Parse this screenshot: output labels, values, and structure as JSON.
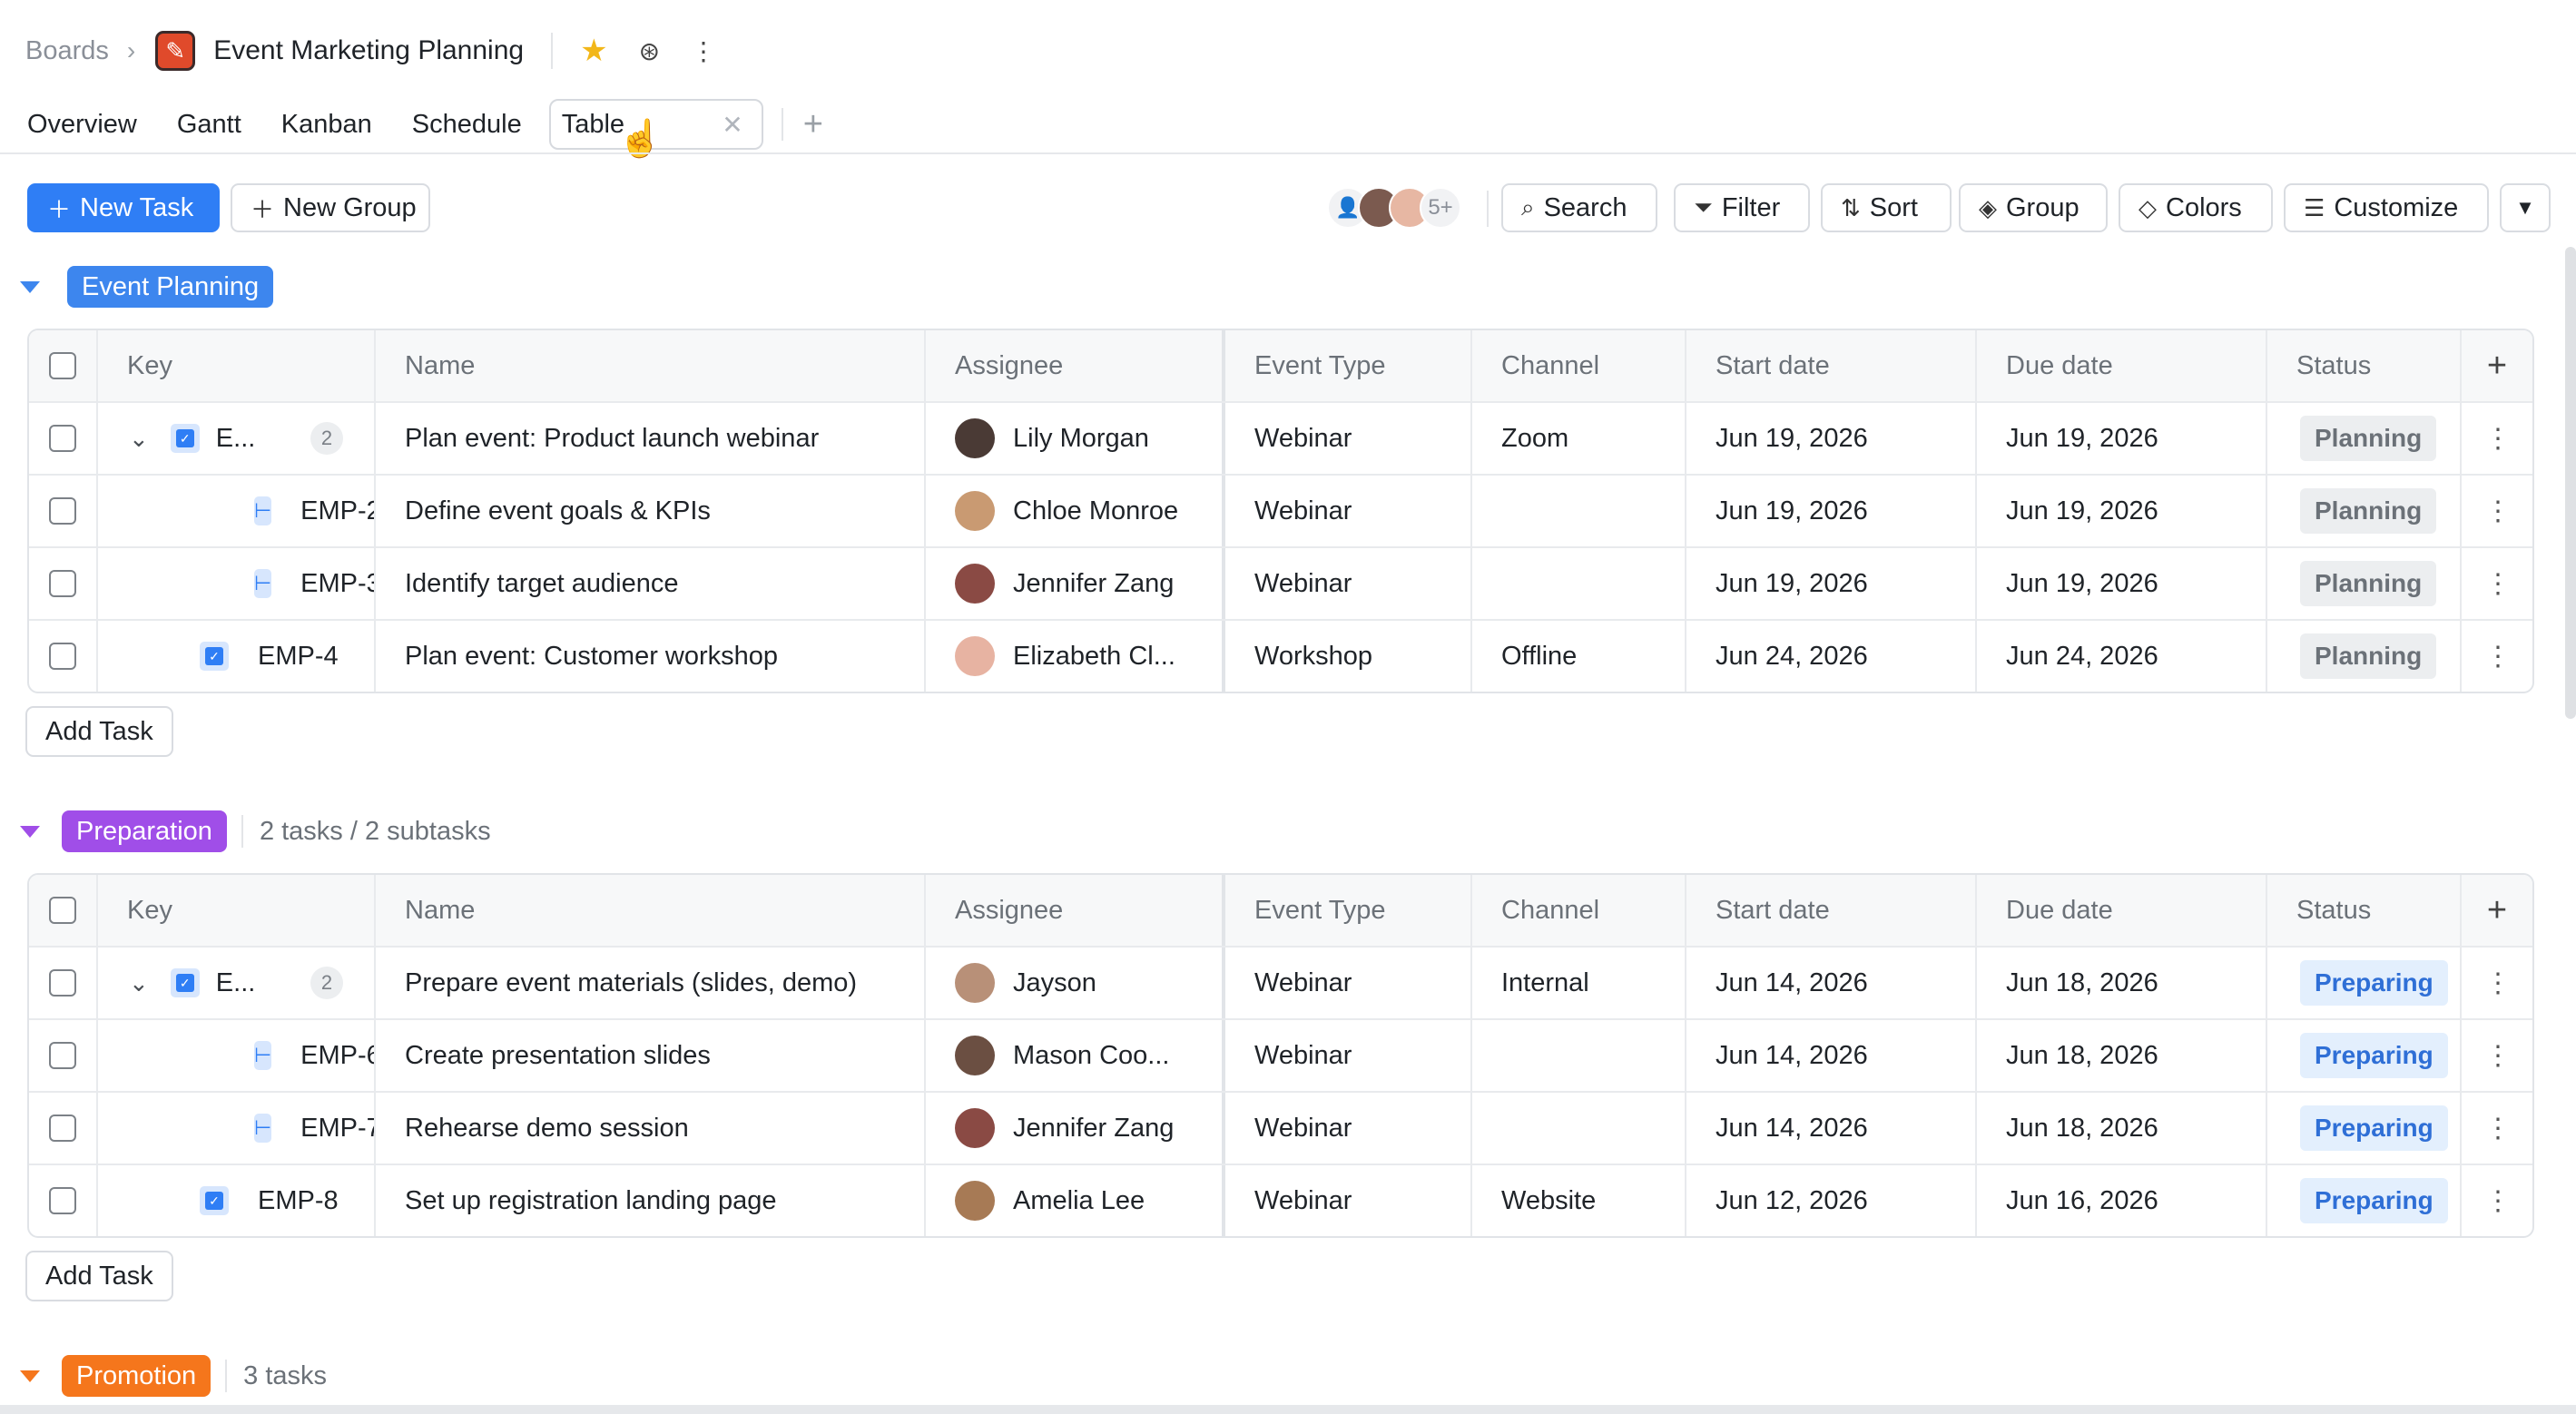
{
  "breadcrumb": {
    "root": "Boards",
    "board_title": "Event Marketing Planning"
  },
  "tabs": [
    {
      "label": "Overview"
    },
    {
      "label": "Gantt"
    },
    {
      "label": "Kanban"
    },
    {
      "label": "Schedule"
    },
    {
      "label": "Table",
      "active": true
    }
  ],
  "toolbar": {
    "new_task": "New Task",
    "new_group": "New Group",
    "members_more": "5+",
    "search": "Search",
    "filter": "Filter",
    "sort": "Sort",
    "group": "Group",
    "colors": "Colors",
    "customize": "Customize"
  },
  "columns": {
    "key": "Key",
    "name": "Name",
    "assignee": "Assignee",
    "event_type": "Event Type",
    "channel": "Channel",
    "start_date": "Start date",
    "due_date": "Due date",
    "status": "Status"
  },
  "add_task_label": "Add Task",
  "colors": {
    "accent": "#2f7ef5",
    "event_planning": "#3d86ee",
    "preparation": "#a04ee8",
    "promotion": "#f5761c"
  },
  "groups": [
    {
      "name": "Event Planning",
      "rows": [
        {
          "key": "E...",
          "subcount": "2",
          "name": "Plan event: Product launch webinar",
          "assignee": "Lily Morgan",
          "event_type": "Webinar",
          "channel": "Zoom",
          "start": "Jun 19, 2026",
          "due": "Jun 19, 2026",
          "status": "Planning"
        },
        {
          "key": "EMP-2",
          "name": "Define event goals & KPIs",
          "assignee": "Chloe Monroe",
          "event_type": "Webinar",
          "channel": "",
          "start": "Jun 19, 2026",
          "due": "Jun 19, 2026",
          "status": "Planning"
        },
        {
          "key": "EMP-3",
          "name": "Identify target audience",
          "assignee": "Jennifer Zang",
          "event_type": "Webinar",
          "channel": "",
          "start": "Jun 19, 2026",
          "due": "Jun 19, 2026",
          "status": "Planning"
        },
        {
          "key": "EMP-4",
          "name": "Plan event: Customer workshop",
          "assignee": "Elizabeth Cl...",
          "event_type": "Workshop",
          "channel": "Offline",
          "start": "Jun 24, 2026",
          "due": "Jun 24, 2026",
          "status": "Planning"
        }
      ]
    },
    {
      "name": "Preparation",
      "count": "2 tasks / 2 subtasks",
      "rows": [
        {
          "key": "E...",
          "subcount": "2",
          "name": "Prepare event materials (slides, demo)",
          "assignee": "Jayson",
          "event_type": "Webinar",
          "channel": "Internal",
          "start": "Jun 14, 2026",
          "due": "Jun 18, 2026",
          "status": "Preparing"
        },
        {
          "key": "EMP-6",
          "name": "Create presentation slides",
          "assignee": "Mason Coo...",
          "event_type": "Webinar",
          "channel": "",
          "start": "Jun 14, 2026",
          "due": "Jun 18, 2026",
          "status": "Preparing"
        },
        {
          "key": "EMP-7",
          "name": "Rehearse demo session",
          "assignee": "Jennifer Zang",
          "event_type": "Webinar",
          "channel": "",
          "start": "Jun 14, 2026",
          "due": "Jun 18, 2026",
          "status": "Preparing"
        },
        {
          "key": "EMP-8",
          "name": "Set up registration landing page",
          "assignee": "Amelia Lee",
          "event_type": "Webinar",
          "channel": "Website",
          "start": "Jun 12, 2026",
          "due": "Jun 16, 2026",
          "status": "Preparing"
        }
      ]
    },
    {
      "name": "Promotion",
      "count": "3 tasks"
    }
  ]
}
